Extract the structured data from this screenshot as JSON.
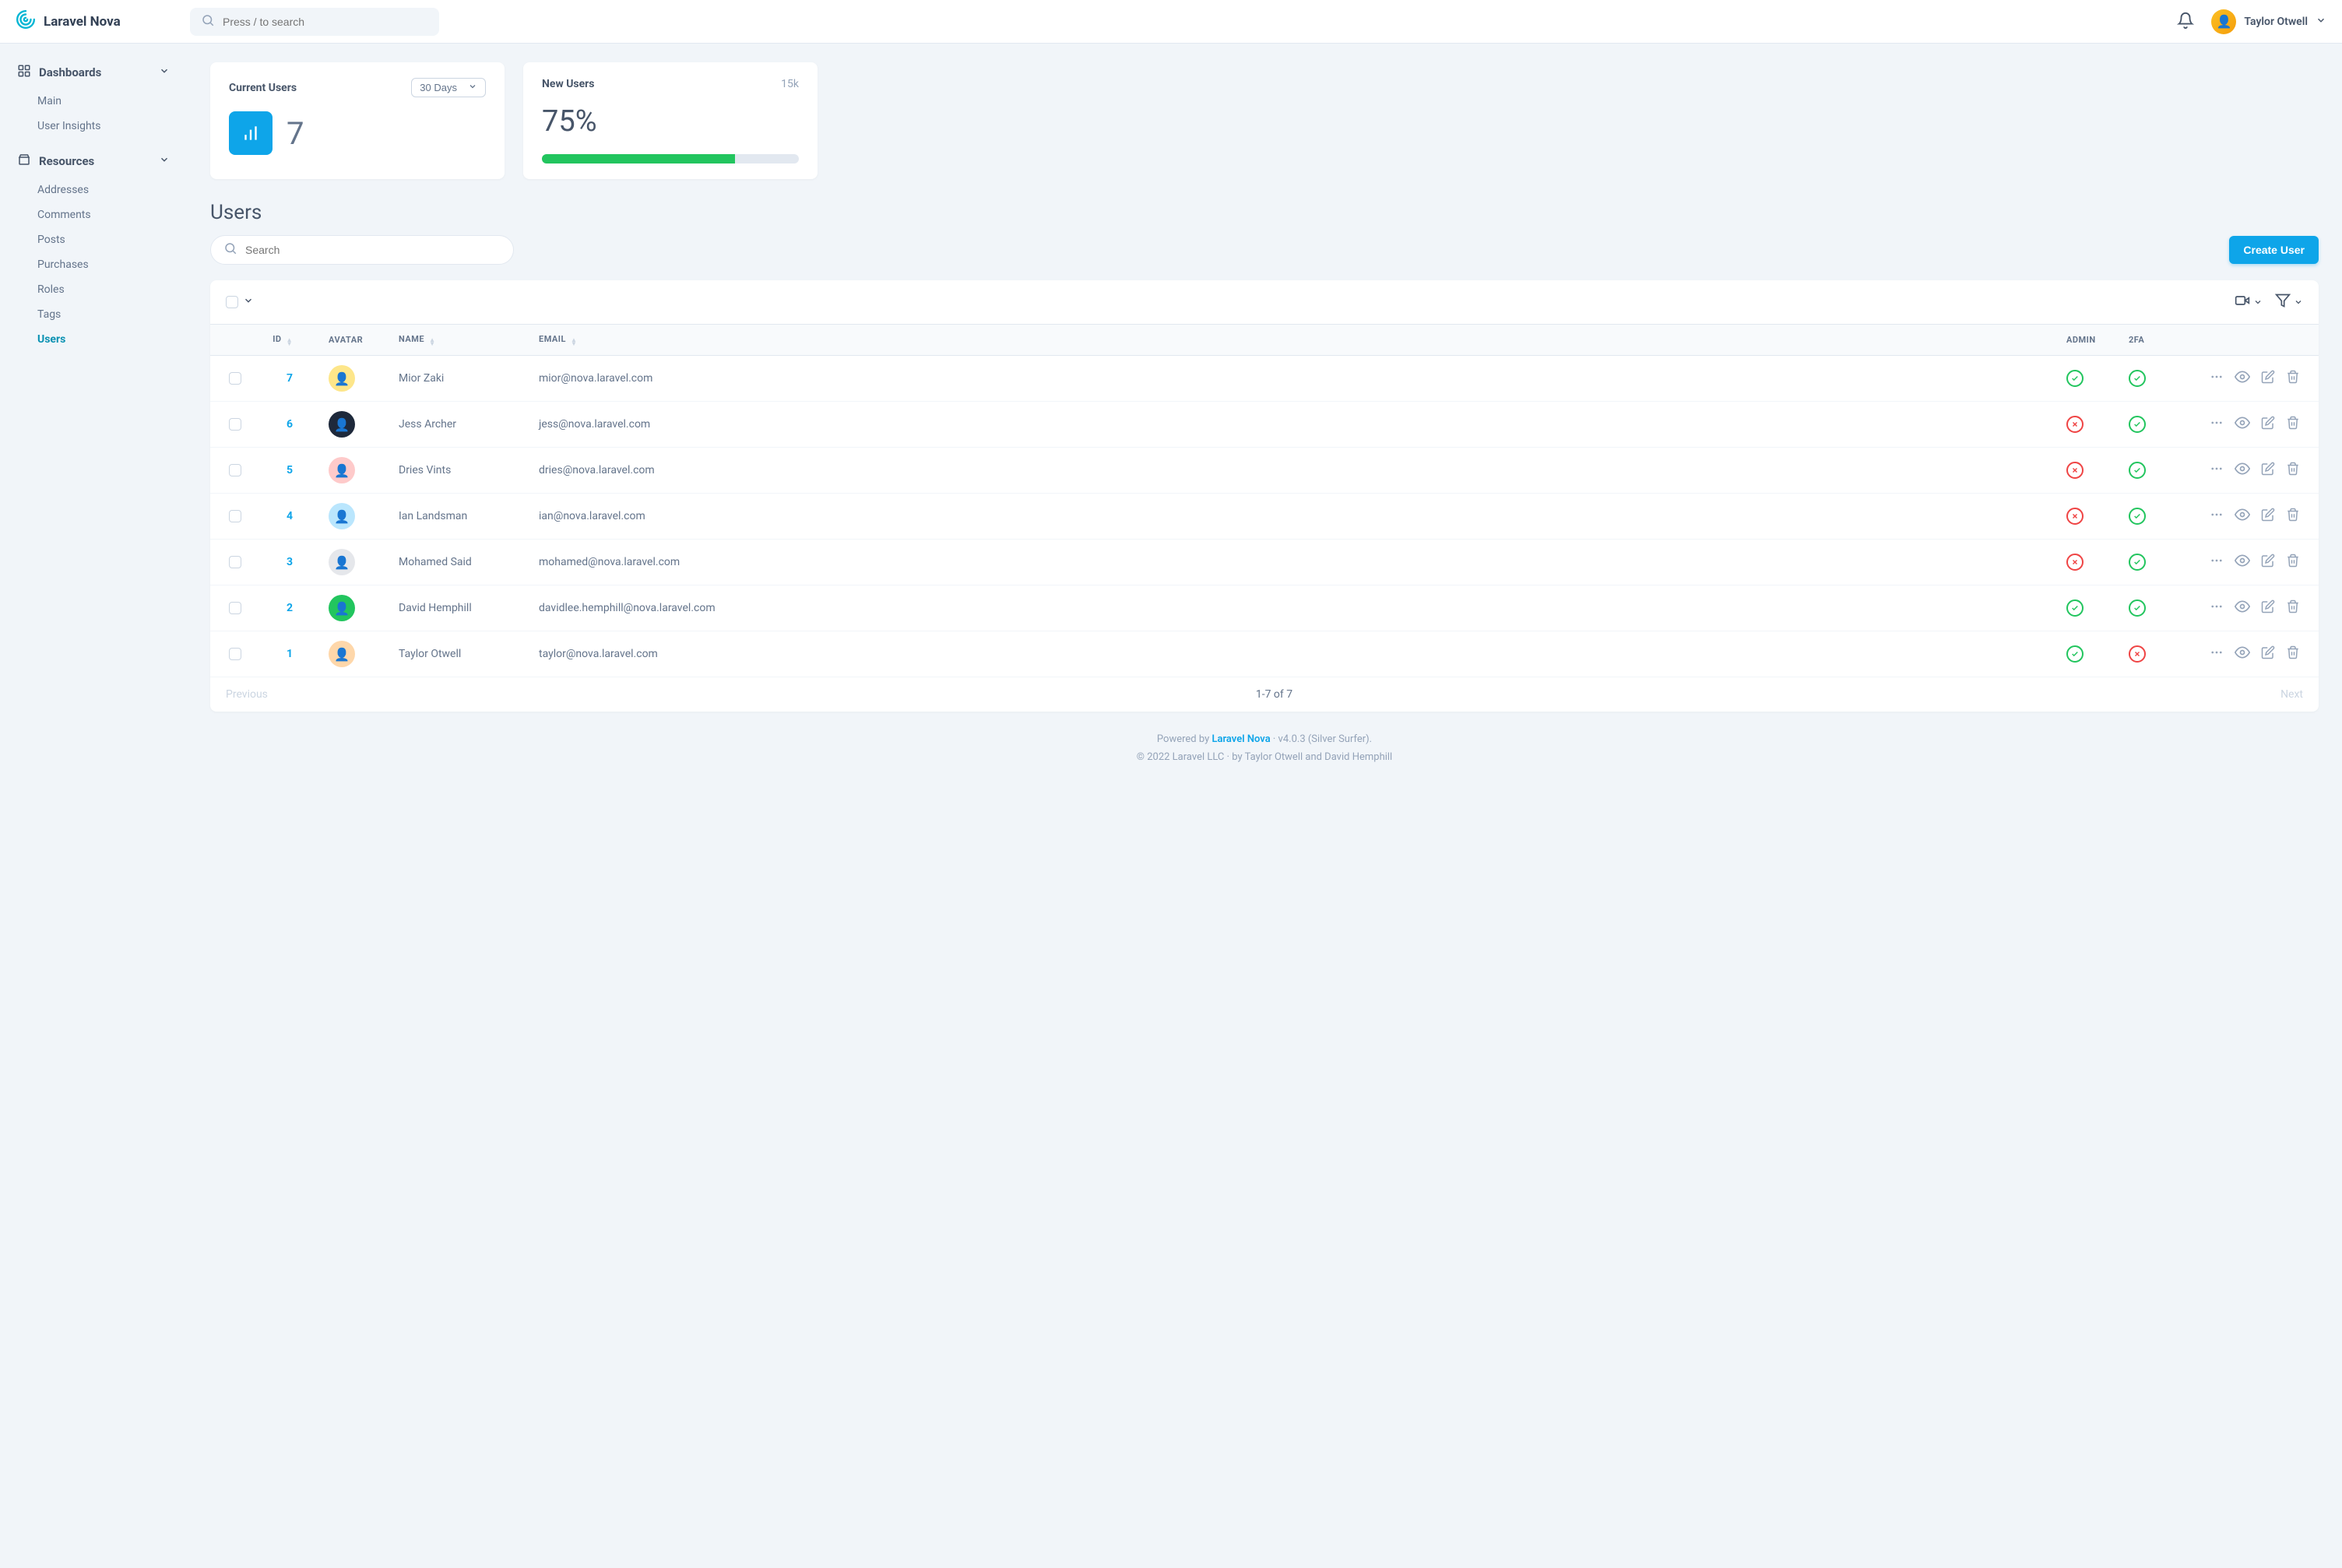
{
  "brand": "Laravel Nova",
  "search_placeholder": "Press / to search",
  "user": {
    "name": "Taylor Otwell"
  },
  "sidebar": {
    "dashboards": {
      "label": "Dashboards",
      "items": [
        {
          "label": "Main"
        },
        {
          "label": "User Insights"
        }
      ]
    },
    "resources": {
      "label": "Resources",
      "items": [
        {
          "label": "Addresses"
        },
        {
          "label": "Comments"
        },
        {
          "label": "Posts"
        },
        {
          "label": "Purchases"
        },
        {
          "label": "Roles"
        },
        {
          "label": "Tags"
        },
        {
          "label": "Users",
          "active": true
        }
      ]
    }
  },
  "cards": {
    "current_users": {
      "title": "Current Users",
      "range": "30 Days",
      "value": "7"
    },
    "new_users": {
      "title": "New Users",
      "badge": "15k",
      "percent": "75%",
      "progress": 75
    }
  },
  "page": {
    "title": "Users",
    "search_placeholder": "Search",
    "create_label": "Create User"
  },
  "table": {
    "headers": {
      "id": "ID",
      "avatar": "AVATAR",
      "name": "NAME",
      "email": "EMAIL",
      "admin": "ADMIN",
      "twofa": "2FA"
    },
    "rows": [
      {
        "id": "7",
        "name": "Mior Zaki",
        "email": "mior@nova.laravel.com",
        "admin": true,
        "twofa": true,
        "avatar_color": "#fde68a"
      },
      {
        "id": "6",
        "name": "Jess Archer",
        "email": "jess@nova.laravel.com",
        "admin": false,
        "twofa": true,
        "avatar_color": "#1e293b"
      },
      {
        "id": "5",
        "name": "Dries Vints",
        "email": "dries@nova.laravel.com",
        "admin": false,
        "twofa": true,
        "avatar_color": "#fecaca"
      },
      {
        "id": "4",
        "name": "Ian Landsman",
        "email": "ian@nova.laravel.com",
        "admin": false,
        "twofa": true,
        "avatar_color": "#bae6fd"
      },
      {
        "id": "3",
        "name": "Mohamed Said",
        "email": "mohamed@nova.laravel.com",
        "admin": false,
        "twofa": true,
        "avatar_color": "#e5e7eb"
      },
      {
        "id": "2",
        "name": "David Hemphill",
        "email": "davidlee.hemphill@nova.laravel.com",
        "admin": true,
        "twofa": true,
        "avatar_color": "#22c55e"
      },
      {
        "id": "1",
        "name": "Taylor Otwell",
        "email": "taylor@nova.laravel.com",
        "admin": true,
        "twofa": false,
        "avatar_color": "#fed7aa"
      }
    ]
  },
  "pagination": {
    "prev": "Previous",
    "info": "1-7 of 7",
    "next": "Next"
  },
  "footer": {
    "powered": "Powered by ",
    "brand": "Laravel Nova",
    "version": " · v4.0.3 (Silver Surfer).",
    "copyright": "© 2022 Laravel LLC · by Taylor Otwell and David Hemphill"
  }
}
